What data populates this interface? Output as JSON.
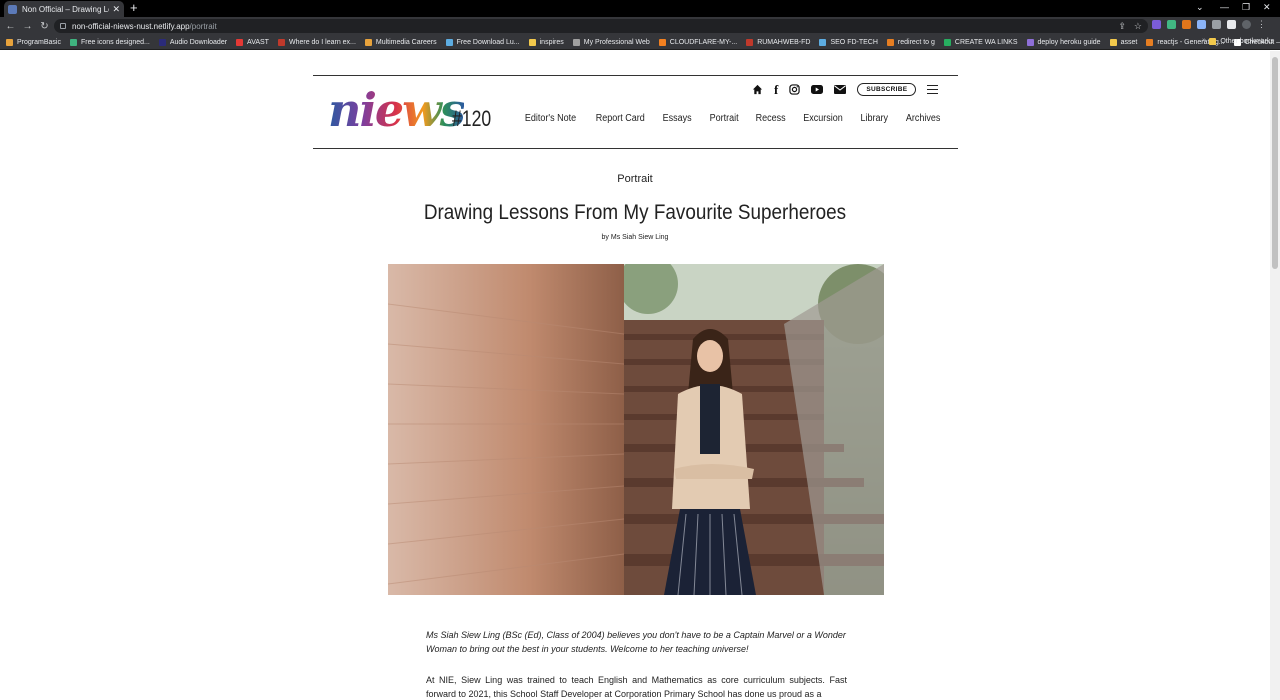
{
  "browser": {
    "tab_title": "Non Official – Drawing Lessons From My Favourite Superheroes",
    "url_host": "non-official-niews-nust.netlify.app",
    "url_path": "/portrait",
    "bookmarks": [
      {
        "label": "ProgramBasic",
        "color": "#e8a33c"
      },
      {
        "label": "Free icons designed...",
        "color": "#3fb37f"
      },
      {
        "label": "Audio Downloader",
        "color": "#2b2b7a"
      },
      {
        "label": "AVAST",
        "color": "#e53935"
      },
      {
        "label": "Where do I learn ex...",
        "color": "#c0392b"
      },
      {
        "label": "Multimedia Careers",
        "color": "#e8a33c"
      },
      {
        "label": "Free Download Lu...",
        "color": "#5dade2"
      },
      {
        "label": "inspires",
        "color": "#f2c94c"
      },
      {
        "label": "My Professional Web",
        "color": "#a0a0a0"
      },
      {
        "label": "CLOUDFLARE-MY-...",
        "color": "#f38020"
      },
      {
        "label": "RUMAHWEB-FD",
        "color": "#c0392b"
      },
      {
        "label": "SEO FD-TECH",
        "color": "#5dade2"
      },
      {
        "label": "redirect to g",
        "color": "#e67e22"
      },
      {
        "label": "CREATE WA LINKS",
        "color": "#27ae60"
      },
      {
        "label": "deploy heroku guide",
        "color": "#8e6fd8"
      },
      {
        "label": "asset",
        "color": "#f2c94c"
      },
      {
        "label": "reactjs - Generating...",
        "color": "#e67e22"
      },
      {
        "label": "Checkout – Basel",
        "color": "#ffffff"
      }
    ],
    "other_bookmarks": "Other bookmarks",
    "more_bookmarks": "»"
  },
  "site": {
    "logo": "niews",
    "issue": "#120",
    "subscribe": "SUBSCRIBE",
    "nav": [
      "Editor's Note",
      "Report Card",
      "Essays",
      "Portrait",
      "Recess",
      "Excursion",
      "Library",
      "Archives"
    ]
  },
  "article": {
    "category": "Portrait",
    "title": "Drawing Lessons From My Favourite Superheroes",
    "byline": "by Ms Siah Siew Ling",
    "intro": "Ms Siah Siew Ling (BSc (Ed), Class of 2004) believes you don't have to be a Captain Marvel or a Wonder Woman to bring out the best in your students. Welcome to her teaching universe!",
    "body": "At NIE, Siew Ling was trained to teach English and Mathematics as core curriculum subjects. Fast forward to 2021, this School Staff Developer at Corporation Primary School has done us proud as a"
  }
}
